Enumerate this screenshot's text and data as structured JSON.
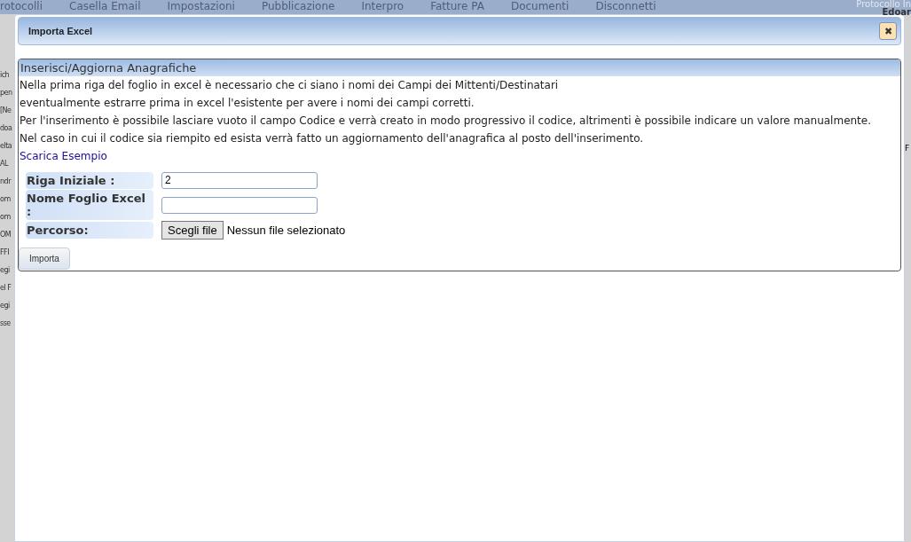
{
  "background_menu": [
    "rotocolli",
    "Casella Email",
    "Impostazioni",
    "Pubblicazione",
    "Interpro",
    "Fatture PA",
    "Documenti",
    "Disconnetti"
  ],
  "background_user": {
    "app": "Protocollo In",
    "name": "Edoar"
  },
  "background_left": [
    "ich",
    "pen",
    "[Ne",
    "doa",
    "elta",
    "AL",
    "ndr",
    "om",
    "om",
    "OM",
    "FFI",
    "egi",
    "el F",
    "egi",
    "sse"
  ],
  "background_right": [
    "F"
  ],
  "dialog": {
    "title": "Importa Excel",
    "close": "✖"
  },
  "panel": {
    "title": "Inserisci/Aggiorna Anagrafiche",
    "lines": [
      "Nella prima riga del foglio in excel è necessario che ci siano i nomi dei Campi dei Mittenti/Destinatari",
      "eventualmente estrarre prima in excel l'esistente per avere i nomi dei campi corretti.",
      "Per l'inserimento è possibile lasciare vuoto il campo Codice e verrà creato in modo progressivo il codice, altrimenti è possibile indicare un valore manualmente.",
      "Nel caso in cui il codice sia riempito ed esista verrà fatto un aggiornamento dell'anagrafica al posto dell'inserimento."
    ],
    "link": "Scarica Esempio",
    "fields": [
      {
        "kind": "text",
        "label": "Riga Iniziale :",
        "value": "2"
      },
      {
        "kind": "text",
        "label": "Nome Foglio Excel :"
      },
      {
        "kind": "file",
        "label": "Percorso:",
        "button": "Scegli file",
        "status": "Nessun file selezionato"
      }
    ],
    "submit": "Importa"
  }
}
